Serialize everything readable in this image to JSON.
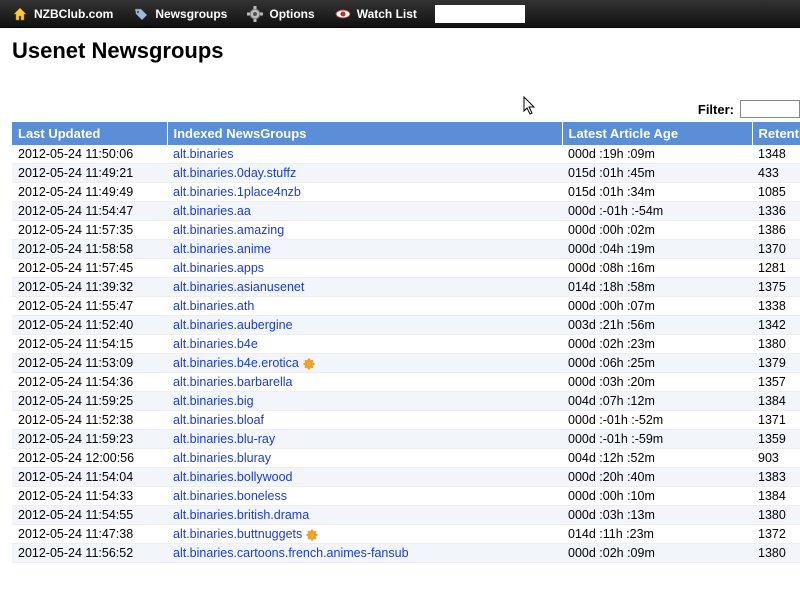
{
  "topnav": {
    "items": [
      {
        "label": "NZBClub.com"
      },
      {
        "label": "Newsgroups"
      },
      {
        "label": "Options"
      },
      {
        "label": "Watch List"
      }
    ],
    "search_value": ""
  },
  "page": {
    "title": "Usenet Newsgroups"
  },
  "filter": {
    "label": "Filter:",
    "value": ""
  },
  "columns": {
    "updated": "Last Updated",
    "name": "Indexed NewsGroups",
    "age": "Latest Article Age",
    "retention": "Retention"
  },
  "rows": [
    {
      "updated": "2012-05-24 11:50:06",
      "name": "alt.binaries",
      "age": "000d :19h :09m",
      "retention": "1348",
      "adult": false
    },
    {
      "updated": "2012-05-24 11:49:21",
      "name": "alt.binaries.0day.stuffz",
      "age": "015d :01h :45m",
      "retention": "433",
      "adult": false
    },
    {
      "updated": "2012-05-24 11:49:49",
      "name": "alt.binaries.1place4nzb",
      "age": "015d :01h :34m",
      "retention": "1085",
      "adult": false
    },
    {
      "updated": "2012-05-24 11:54:47",
      "name": "alt.binaries.aa",
      "age": "000d :-01h :-54m",
      "retention": "1336",
      "adult": false
    },
    {
      "updated": "2012-05-24 11:57:35",
      "name": "alt.binaries.amazing",
      "age": "000d :00h :02m",
      "retention": "1386",
      "adult": false
    },
    {
      "updated": "2012-05-24 11:58:58",
      "name": "alt.binaries.anime",
      "age": "000d :04h :19m",
      "retention": "1370",
      "adult": false
    },
    {
      "updated": "2012-05-24 11:57:45",
      "name": "alt.binaries.apps",
      "age": "000d :08h :16m",
      "retention": "1281",
      "adult": false
    },
    {
      "updated": "2012-05-24 11:39:32",
      "name": "alt.binaries.asianusenet",
      "age": "014d :18h :58m",
      "retention": "1375",
      "adult": false
    },
    {
      "updated": "2012-05-24 11:55:47",
      "name": "alt.binaries.ath",
      "age": "000d :00h :07m",
      "retention": "1338",
      "adult": false
    },
    {
      "updated": "2012-05-24 11:52:40",
      "name": "alt.binaries.aubergine",
      "age": "003d :21h :56m",
      "retention": "1342",
      "adult": false
    },
    {
      "updated": "2012-05-24 11:54:15",
      "name": "alt.binaries.b4e",
      "age": "000d :02h :23m",
      "retention": "1380",
      "adult": false
    },
    {
      "updated": "2012-05-24 11:53:09",
      "name": "alt.binaries.b4e.erotica",
      "age": "000d :06h :25m",
      "retention": "1379",
      "adult": true
    },
    {
      "updated": "2012-05-24 11:54:36",
      "name": "alt.binaries.barbarella",
      "age": "000d :03h :20m",
      "retention": "1357",
      "adult": false
    },
    {
      "updated": "2012-05-24 11:59:25",
      "name": "alt.binaries.big",
      "age": "004d :07h :12m",
      "retention": "1384",
      "adult": false
    },
    {
      "updated": "2012-05-24 11:52:38",
      "name": "alt.binaries.bloaf",
      "age": "000d :-01h :-52m",
      "retention": "1371",
      "adult": false
    },
    {
      "updated": "2012-05-24 11:59:23",
      "name": "alt.binaries.blu-ray",
      "age": "000d :-01h :-59m",
      "retention": "1359",
      "adult": false
    },
    {
      "updated": "2012-05-24 12:00:56",
      "name": "alt.binaries.bluray",
      "age": "004d :12h :52m",
      "retention": "903",
      "adult": false
    },
    {
      "updated": "2012-05-24 11:54:04",
      "name": "alt.binaries.bollywood",
      "age": "000d :20h :40m",
      "retention": "1383",
      "adult": false
    },
    {
      "updated": "2012-05-24 11:54:33",
      "name": "alt.binaries.boneless",
      "age": "000d :00h :10m",
      "retention": "1384",
      "adult": false
    },
    {
      "updated": "2012-05-24 11:54:55",
      "name": "alt.binaries.british.drama",
      "age": "000d :03h :13m",
      "retention": "1380",
      "adult": false
    },
    {
      "updated": "2012-05-24 11:47:38",
      "name": "alt.binaries.buttnuggets",
      "age": "014d :11h :23m",
      "retention": "1372",
      "adult": true
    },
    {
      "updated": "2012-05-24 11:56:52",
      "name": "alt.binaries.cartoons.french.animes-fansub",
      "age": "000d :02h :09m",
      "retention": "1380",
      "adult": false
    }
  ]
}
